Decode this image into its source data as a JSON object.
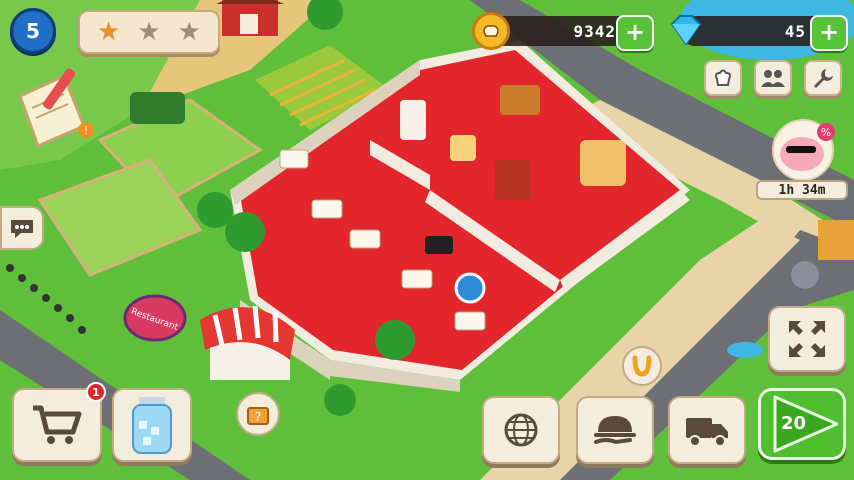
{
  "hud": {
    "level": "5",
    "stars": {
      "earned": 1,
      "total": 3
    },
    "coins": "9342",
    "gems": "45",
    "timer": "1h 34m",
    "cart_badge": "1",
    "play_count": "20"
  },
  "colors": {
    "grass": "#5fbf3a",
    "road": "#6e6f74",
    "sidewalk": "#e9d3a8",
    "carpet": "#e2262c",
    "wall": "#f1ecdf",
    "accent_green": "#55c238",
    "coin": "#f5b828",
    "gem": "#2db8f0",
    "level_badge": "#1f6fc4"
  },
  "icons": {
    "top_right_row": [
      "chef-hat-icon",
      "friends-icon",
      "wrench-icon"
    ],
    "bottom_left": [
      "cart-icon",
      "ice-jar-icon"
    ],
    "bottom_right": [
      "globe-icon",
      "serve-dish-icon",
      "delivery-truck-icon",
      "play-icon"
    ],
    "side": [
      "chat-icon",
      "notepad-pencil-icon",
      "expand-arrows-icon",
      "horseshoe-icon",
      "mystery-box-icon",
      "piggy-bank-icon"
    ]
  },
  "scene": {
    "sign_text": "Restaurant"
  }
}
